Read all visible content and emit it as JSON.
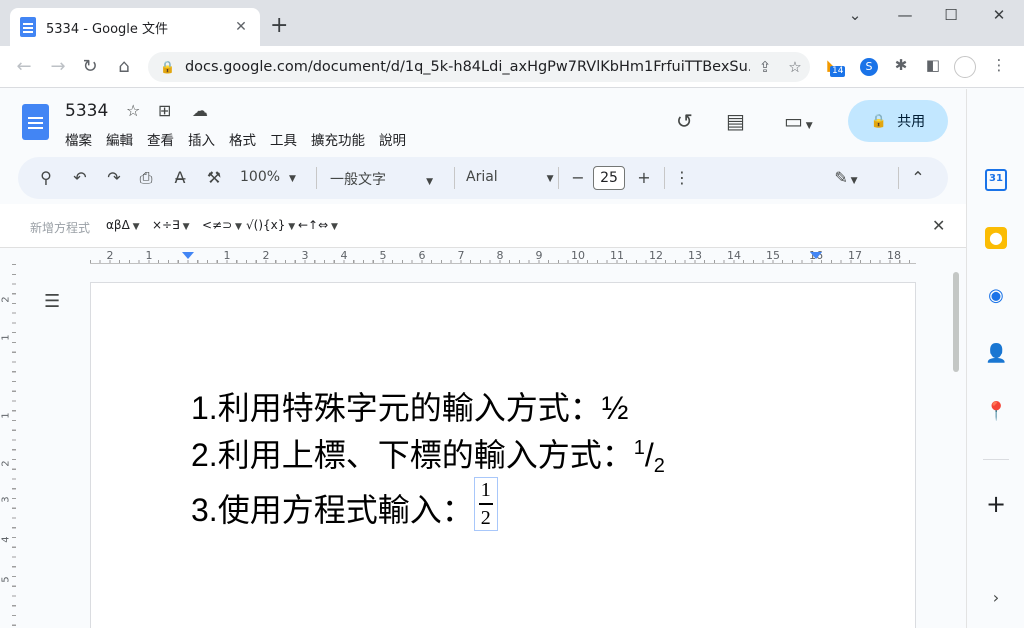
{
  "browser": {
    "tab_title": "5334 - Google 文件",
    "url": "docs.google.com/document/d/1q_5k-h84Ldi_axHgPw7RVlKbHm1FrfuiTTBexSu...",
    "ext_badge": "14"
  },
  "doc": {
    "title": "5334",
    "menu": [
      "檔案",
      "編輯",
      "查看",
      "插入",
      "格式",
      "工具",
      "擴充功能",
      "說明"
    ],
    "share_label": "共用"
  },
  "toolbar": {
    "zoom": "100%",
    "style": "一般文字",
    "font": "Arial",
    "font_size": "25"
  },
  "equation_bar": {
    "label": "新增方程式",
    "groups": [
      "αβΔ",
      "×÷∃",
      "<≠⊃",
      "√(){x}",
      "←↑⇔"
    ]
  },
  "ruler": {
    "labels": [
      "2",
      "1",
      "1",
      "2",
      "3",
      "4",
      "5",
      "6",
      "7",
      "8",
      "9",
      "10",
      "11",
      "12",
      "13",
      "14",
      "15",
      "16",
      "17",
      "18"
    ]
  },
  "left_ruler": {
    "labels": [
      "2",
      "1",
      "1",
      "2",
      "3",
      "4",
      "5"
    ]
  },
  "content": {
    "line1": "1.利用特殊字元的輸入方式：½",
    "line2_prefix": "2.利用上標、下標的輸入方式：",
    "line2_sup": "1",
    "line2_slash": "/",
    "line2_sub": "2",
    "line3_prefix": "3.使用方程式輸入：",
    "eq_numerator": "1",
    "eq_denominator": "2"
  },
  "side_panel": {
    "calendar_day": "31"
  },
  "colors": {
    "accent": "#1a73e8",
    "share_bg": "#c2e7ff",
    "toolbar_bg": "#edf2fa"
  }
}
